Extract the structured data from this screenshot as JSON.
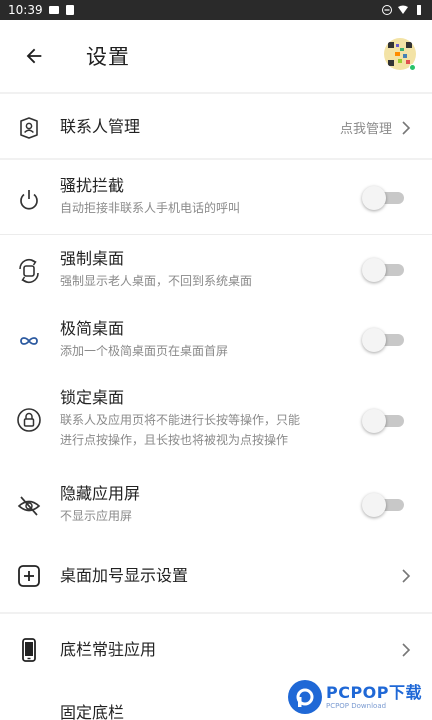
{
  "status_bar": {
    "time": "10:39"
  },
  "header": {
    "title": "设置"
  },
  "rows": {
    "contacts": {
      "label": "联系人管理",
      "action": "点我管理"
    },
    "harass": {
      "label": "骚扰拦截",
      "desc": "自动拒接非联系人手机电话的呼叫",
      "enabled": false
    },
    "force_desktop": {
      "label": "强制桌面",
      "desc": "强制显示老人桌面，不回到系统桌面",
      "enabled": false
    },
    "simple_desktop": {
      "label": "极简桌面",
      "desc": "添加一个极简桌面页在桌面首屏",
      "enabled": false
    },
    "lock_desktop": {
      "label": "锁定桌面",
      "desc_line1": "联系人及应用页将不能进行长按等操作，只能",
      "desc_line2": "进行点按操作，且长按也将被视为点按操作",
      "enabled": false
    },
    "hide_apps": {
      "label": "隐藏应用屏",
      "desc": "不显示应用屏",
      "enabled": false
    },
    "plus_display": {
      "label": "桌面加号显示设置"
    },
    "dock_apps": {
      "label": "底栏常驻应用"
    },
    "fixed_dock": {
      "label": "固定底栏"
    }
  },
  "icons": {
    "back": "arrow-left-icon",
    "contacts": "contacts-icon",
    "harass": "power-icon",
    "force_desktop": "rotate-screen-icon",
    "simple_desktop": "infinity-icon",
    "lock_desktop": "lock-icon",
    "hide_apps": "eye-off-icon",
    "plus_display": "plus-box-icon",
    "dock_apps": "phone-device-icon"
  },
  "colors": {
    "accent_blue": "#1f68d6",
    "toggle_track_off": "#c8c8c8",
    "status_bar": "#2a2a2a"
  },
  "watermark": {
    "text": "PCPOP下载",
    "sub": "PCPOP Download"
  }
}
